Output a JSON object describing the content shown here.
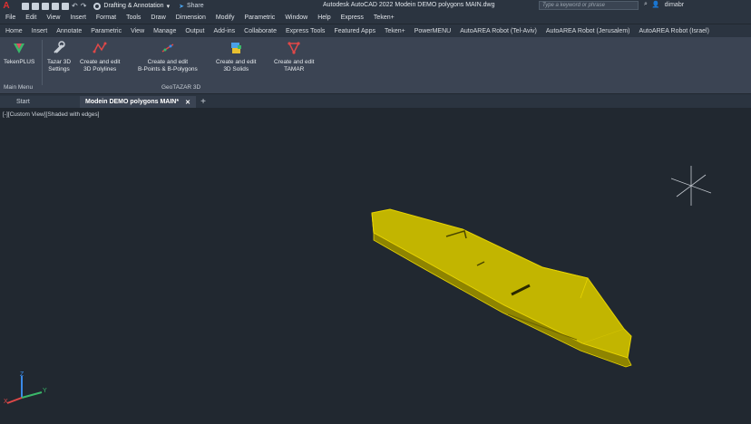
{
  "titlebar": {
    "logo": "A",
    "workspace": "Drafting & Annotation",
    "share": "Share",
    "app_title": "Autodesk AutoCAD 2022    Modein DEMO polygons MAIN.dwg",
    "search_placeholder": "Type a keyword or phrase",
    "user": "dimabr"
  },
  "menubar": [
    "File",
    "Edit",
    "View",
    "Insert",
    "Format",
    "Tools",
    "Draw",
    "Dimension",
    "Modify",
    "Parametric",
    "Window",
    "Help",
    "Express",
    "Teken+"
  ],
  "ribbon_tabs": [
    "Home",
    "Insert",
    "Annotate",
    "Parametric",
    "View",
    "Manage",
    "Output",
    "Add-ins",
    "Collaborate",
    "Express Tools",
    "Featured Apps",
    "Teken+",
    "PowerMENU",
    "AutoAREA Robot (Tel-Aviv)",
    "AutoAREA Robot (Jerusalem)",
    "AutoAREA Robot (Israel)"
  ],
  "ribbon": {
    "tekenplus": "TekenPLUS",
    "main_menu": "Main Menu",
    "tazar_settings_line1": "Tazar 3D",
    "tazar_settings_line2": "Settings",
    "polylines_line1": "Create and edit",
    "polylines_line2": "3D Polylines",
    "points_line1": "Create and edit",
    "points_line2": "B-Points & B-Polygons",
    "solids_line1": "Create and edit",
    "solids_line2": "3D Solids",
    "tamar_line1": "Create and edit",
    "tamar_line2": "TAMAR",
    "panel_label": "GeoTAZAR 3D"
  },
  "file_tabs": {
    "start": "Start",
    "active": "Modein DEMO polygons MAIN*",
    "close": "✕",
    "new": "+"
  },
  "viewport": {
    "label": "[-][Custom View][Shaded with edges]",
    "ucs_x": "X",
    "ucs_y": "Y",
    "ucs_z": "Z"
  },
  "colors": {
    "model_face": "#b3a800",
    "model_edge": "#e8d400",
    "background": "#212830"
  },
  "icons": [
    "autocad-logo-icon",
    "new-icon",
    "open-icon",
    "save-icon",
    "saveas-icon",
    "print-icon",
    "undo-icon",
    "redo-icon",
    "gear-icon",
    "share-icon",
    "search-icon",
    "user-icon",
    "tekenplus-icon",
    "tazar-settings-icon",
    "polyline-icon",
    "points-icon",
    "solids-icon",
    "tamar-icon",
    "crosshair-icon",
    "ucs-icon"
  ]
}
